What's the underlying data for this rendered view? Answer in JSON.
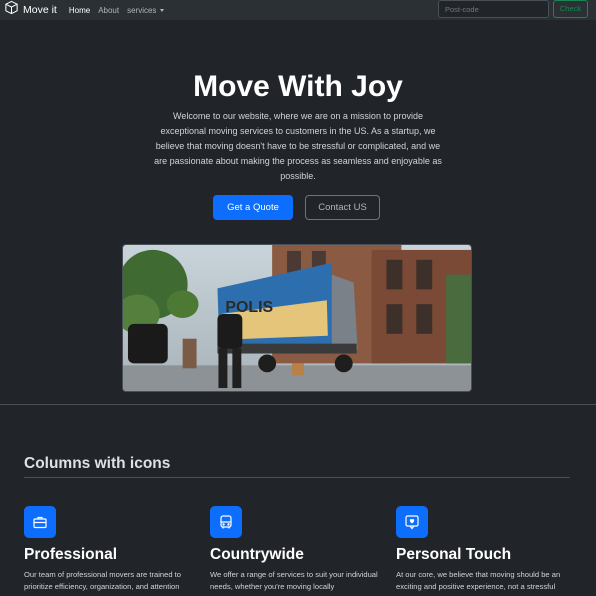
{
  "navbar": {
    "brand": "Move it",
    "links": [
      {
        "label": "Home"
      },
      {
        "label": "About"
      },
      {
        "label": "services"
      }
    ],
    "postcode_placeholder": "Post-code",
    "check_label": "Check"
  },
  "hero": {
    "title": "Move With Joy",
    "text": "Welcome to our website, where we are on a mission to provide exceptional moving services to customers in the US. As a startup, we believe that moving doesn't have to be stressful or complicated, and we are passionate about making the process as seamless and enjoyable as possible.",
    "primary_button": "Get a Quote",
    "secondary_button": "Contact US",
    "truck_lettering": "POLIS"
  },
  "features": {
    "title": "Columns with icons",
    "items": [
      {
        "icon": "briefcase-icon",
        "title": "Professional",
        "text": "Our team of professional movers are trained to prioritize efficiency, organization, and attention"
      },
      {
        "icon": "bus-icon",
        "title": "Countrywide",
        "text": "We offer a range of services to suit your individual needs, whether you're moving locally"
      },
      {
        "icon": "chat-heart-icon",
        "title": "Personal Touch",
        "text": "At our core, we believe that moving should be an exciting and positive experience, not a stressful"
      }
    ]
  },
  "colors": {
    "background": "#212529",
    "navbar": "#2b3035",
    "primary": "#0d6efd",
    "success": "#198754"
  }
}
